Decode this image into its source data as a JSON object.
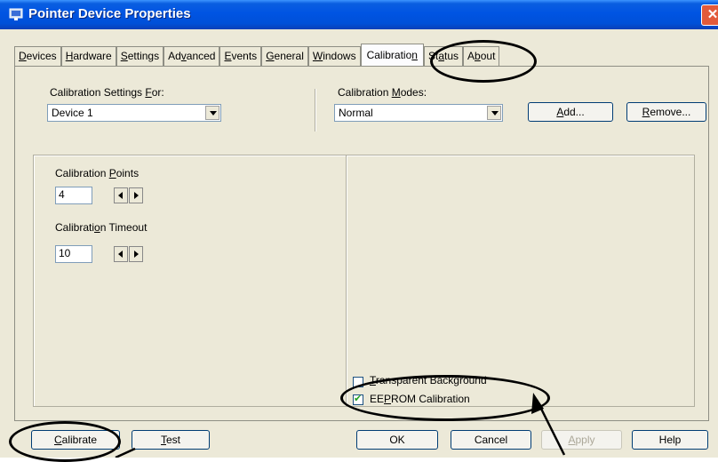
{
  "window": {
    "title": "Pointer Device Properties",
    "close_glyph": "✕"
  },
  "tabs": [
    {
      "label": "Devices"
    },
    {
      "label": "Hardware"
    },
    {
      "label": "Settings"
    },
    {
      "label": "Advanced"
    },
    {
      "label": "Events"
    },
    {
      "label": "General"
    },
    {
      "label": "Windows"
    },
    {
      "label": "Calibration",
      "selected": true
    },
    {
      "label": "Status"
    },
    {
      "label": "About"
    }
  ],
  "calibration_settings_for": {
    "label": "Calibration Settings For:",
    "value": "Device 1"
  },
  "calibration_modes": {
    "label": "Calibration Modes:",
    "value": "Normal",
    "add_label": "Add...",
    "remove_label": "Remove..."
  },
  "points": {
    "label": "Calibration Points",
    "value": "4"
  },
  "timeout": {
    "label": "Calibration Timeout",
    "value": "10"
  },
  "options": {
    "transparent_label": "Transparent Background",
    "transparent_checked": false,
    "eeprom_label": "EEPROM Calibration",
    "eeprom_checked": true
  },
  "buttons": {
    "calibrate": "Calibrate",
    "test": "Test",
    "ok": "OK",
    "cancel": "Cancel",
    "apply": "Apply",
    "help": "Help"
  },
  "colors": {
    "titlebar": "#0054e3",
    "dialog_bg": "#ece9d8",
    "annotation": "#000000"
  }
}
